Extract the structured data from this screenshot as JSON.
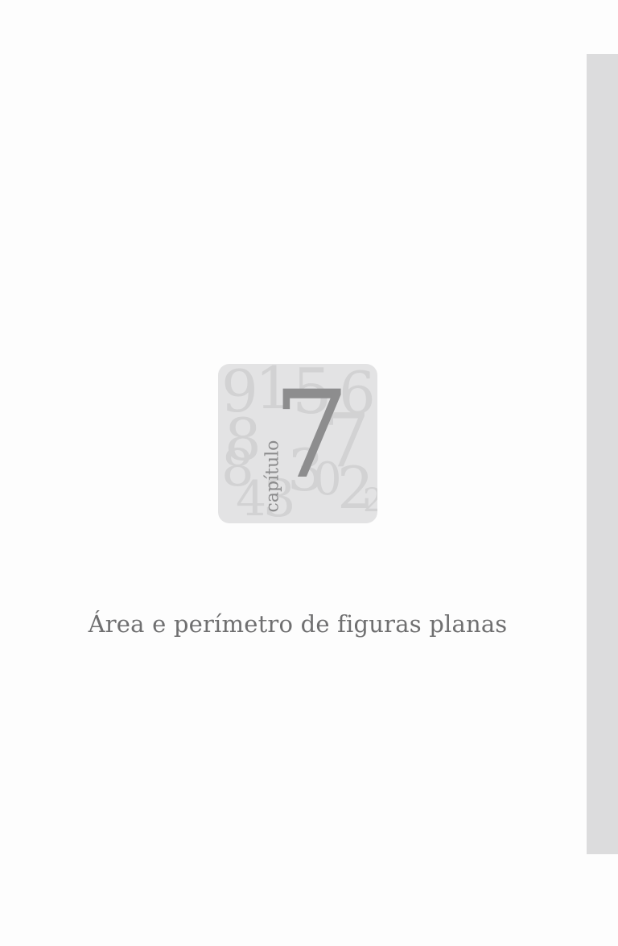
{
  "badge": {
    "label": "capítulo",
    "number": "7",
    "background_digits": [
      "9",
      "1",
      "5",
      "6",
      "8",
      "7",
      "8",
      "3",
      "0",
      "2",
      "4",
      "3",
      "2"
    ]
  },
  "chapter_title": "Área e perímetro de figuras planas",
  "colors": {
    "side_tab": "#dcdcdd",
    "badge_background": "#e3e3e4",
    "background_digits": "#d2d2d3",
    "chapter_number": "#8d8d8e",
    "title_text": "#6f6f70"
  }
}
